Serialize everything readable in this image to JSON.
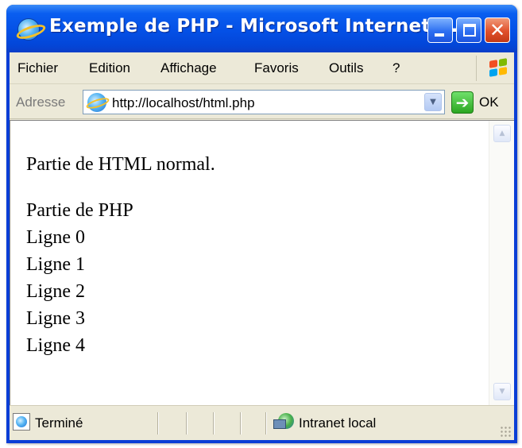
{
  "window": {
    "title": "Exemple de PHP - Microsoft Internet ...",
    "icon": "internet-explorer-icon",
    "controls": {
      "minimize": "minimize-icon",
      "maximize": "maximize-icon",
      "close": "✕"
    }
  },
  "menubar": {
    "items": [
      "Fichier",
      "Edition",
      "Affichage",
      "Favoris",
      "Outils",
      "?"
    ],
    "logo": "windows-logo-icon"
  },
  "addressbar": {
    "label": "Adresse",
    "url": "http://localhost/html.php",
    "dropdown_icon": "chevron-down-icon",
    "go_icon": "go-arrow-icon",
    "go_label": "OK"
  },
  "content": {
    "paragraph": "Partie de HTML normal.",
    "php_heading": "Partie de PHP",
    "lines": [
      "Ligne 0",
      "Ligne 1",
      "Ligne 2",
      "Ligne 3",
      "Ligne 4"
    ]
  },
  "statusbar": {
    "status": "Terminé",
    "zone": "Intranet local"
  },
  "colors": {
    "titlebar": "#0450e6",
    "chrome": "#ece9d8",
    "close_button": "#e0502b",
    "go_button": "#2ba621"
  }
}
